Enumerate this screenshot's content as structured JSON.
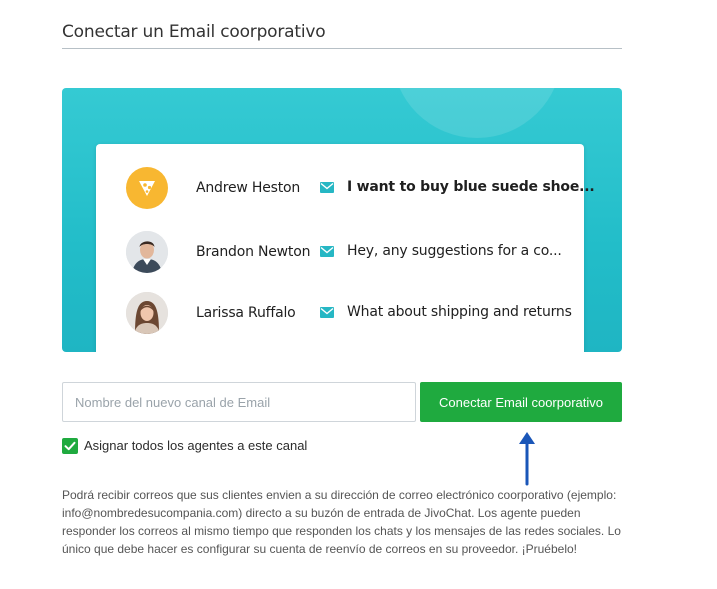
{
  "page": {
    "title": "Conectar un Email coorporativo"
  },
  "conversations": [
    {
      "name": "Andrew Heston",
      "message": "I want to buy blue suede shoe...",
      "avatar": "brand-logo-icon",
      "bold": true
    },
    {
      "name": "Brandon Newton",
      "message": "Hey, any suggestions for a co...",
      "avatar": "person-avatar",
      "bold": false
    },
    {
      "name": "Larissa Ruffalo",
      "message": "What about shipping and returns",
      "avatar": "person-avatar",
      "bold": false
    }
  ],
  "form": {
    "channel_placeholder": "Nombre del nuevo canal de Email",
    "channel_value": "",
    "connect_button": "Conectar Email coorporativo",
    "assign_all_label": "Asignar todos los agentes a este canal",
    "assign_all_checked": true
  },
  "description": "Podrá recibir correos que sus clientes envien a su dirección de correo electrónico coorporativo (ejemplo: info@nombredesucompania.com) directo a su buzón de entrada de JivoChat. Los agente pueden responder los correos al mismo tiempo que responden los chats y los mensajes de las redes sociales. Lo único que debe hacer es configurar su cuenta de reenvío de correos en su proveedor. ¡Pruébelo!",
  "colors": {
    "accent_green": "#1faa3f",
    "banner_teal": "#22bdc9",
    "mail_icon_teal": "#26b7c4",
    "logo_yellow": "#f8b731",
    "annotation_arrow": "#1a56b8"
  }
}
